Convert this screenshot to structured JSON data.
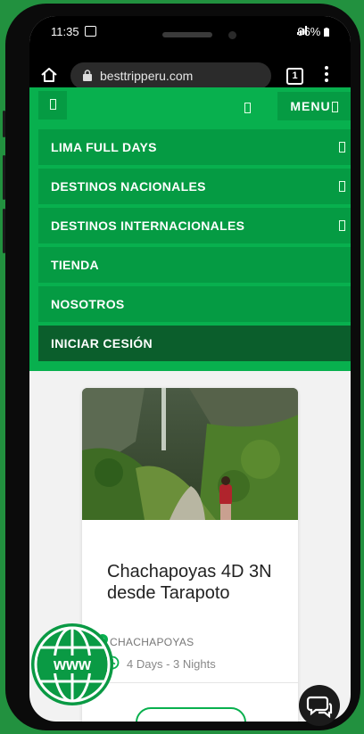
{
  "status_bar": {
    "time": "11:35",
    "signal": "4G",
    "battery": "96%"
  },
  "browser": {
    "url": "besttripperu.com",
    "tab_count": "1"
  },
  "site_header": {
    "left_glyph": "",
    "menu_label": "MENU",
    "nav_items": [
      {
        "label": "LIMA FULL DAYS",
        "has_submenu": true
      },
      {
        "label": "DESTINOS NACIONALES",
        "has_submenu": true
      },
      {
        "label": "DESTINOS INTERNACIONALES",
        "has_submenu": true
      },
      {
        "label": "TIENDA",
        "has_submenu": false
      },
      {
        "label": "NOSOTROS",
        "has_submenu": false
      },
      {
        "label": "INICIAR CESIÓN",
        "has_submenu": false,
        "active": true
      }
    ]
  },
  "tour_card": {
    "title": "Chachapoyas 4D 3N desde Tarapoto",
    "location": "CHACHAPOYAS",
    "duration": "4 Days - 3 Nights",
    "button_label": ""
  },
  "badge": {
    "text": "www"
  },
  "colors": {
    "brand_green": "#08b04e",
    "nav_green": "#059b43",
    "active_nav": "#0b5e2c",
    "frame_bg": "#22913f"
  }
}
